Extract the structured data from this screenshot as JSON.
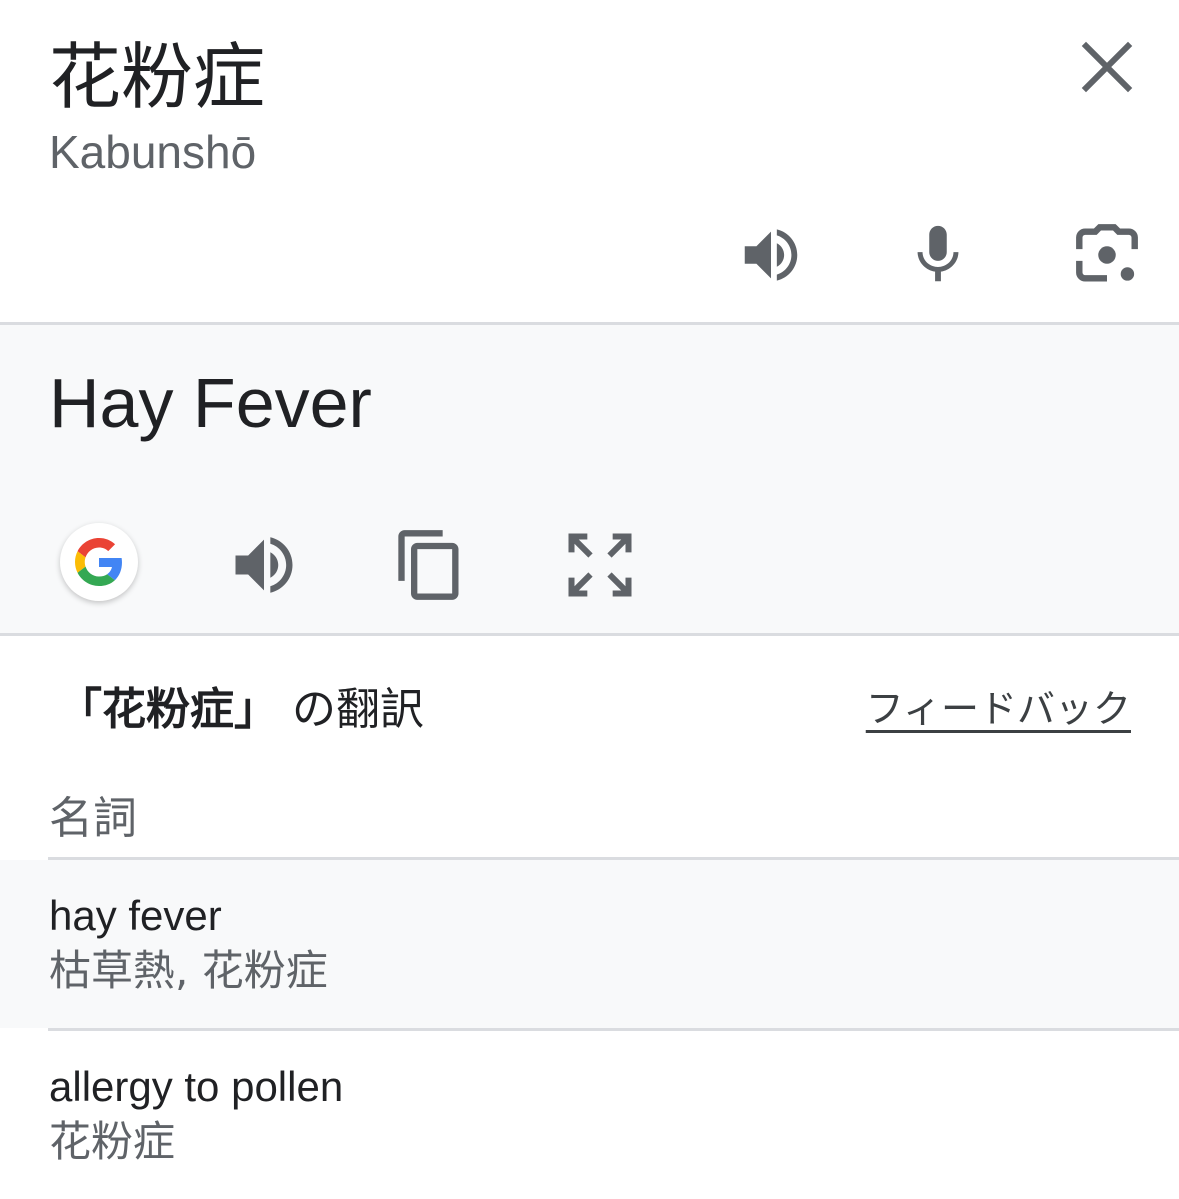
{
  "source": {
    "text": "花粉症",
    "romanization": "Kabunshō"
  },
  "target": {
    "text": "Hay Fever"
  },
  "icons": {
    "close": "close-icon",
    "source_actions": [
      "speaker-icon",
      "microphone-icon",
      "camera-lens-icon"
    ],
    "target_actions": [
      "google-logo-icon",
      "speaker-icon",
      "copy-icon",
      "fullscreen-icon"
    ]
  },
  "translations": {
    "heading_term": "「花粉症」",
    "heading_suffix": " の翻訳",
    "feedback_label": "フィードバック",
    "part_of_speech": "名詞",
    "entries": [
      {
        "word": "hay fever",
        "reverse": "枯草熱, 花粉症"
      },
      {
        "word": "allergy to pollen",
        "reverse": "花粉症"
      }
    ]
  },
  "colors": {
    "icon_gray": "#5f6368",
    "panel_bg": "#f8f9fa",
    "divider": "#dadce0"
  }
}
